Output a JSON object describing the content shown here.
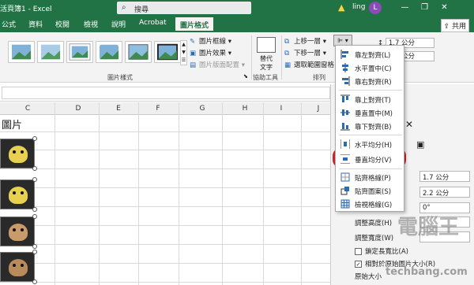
{
  "titlebar": {
    "title": "活頁簿1 - Excel",
    "search_placeholder": "搜尋",
    "user_name": "ling",
    "avatar_initial": "L",
    "minimize": "—",
    "restore": "❐",
    "close": "✕",
    "colors": {
      "accent": "#217346",
      "avatar": "#8b4bb9",
      "warning": "#ffd23a"
    }
  },
  "ribbon_tabs": [
    "公式",
    "資料",
    "校閱",
    "檢視",
    "說明",
    "Acrobat",
    "圖片格式"
  ],
  "active_tab": "圖片格式",
  "share_button": "共用",
  "ribbon": {
    "picture_border": "圖片框線",
    "picture_effects": "圖片效果",
    "picture_layout": "圖片版面配置",
    "picture_styles_group": "圖片樣式",
    "alt_text_line1": "替代",
    "alt_text_line2": "文字",
    "accessibility_group": "協助工具",
    "bring_forward": "上移一層",
    "send_backward": "下移一層",
    "selection_pane": "選取範圍窗格",
    "arrange_group": "排列",
    "height_value": "1.7 公分",
    "width_value": "2.2 公分"
  },
  "grid": {
    "columns": [
      "C",
      "D",
      "E",
      "F",
      "G",
      "H",
      "I",
      "J"
    ],
    "cell_heading": "圖片"
  },
  "align_menu": {
    "items": [
      {
        "label": "靠左對齊(L)",
        "icon": "align-left-icon"
      },
      {
        "label": "水平置中(C)",
        "icon": "align-center-icon"
      },
      {
        "label": "靠右對齊(R)",
        "icon": "align-right-icon"
      },
      {
        "label": "靠上對齊(T)",
        "icon": "align-top-icon"
      },
      {
        "label": "垂直置中(M)",
        "icon": "align-middle-icon"
      },
      {
        "label": "靠下對齊(B)",
        "icon": "align-bottom-icon"
      },
      {
        "label": "水平均分(H)",
        "icon": "distribute-horizontal-icon"
      },
      {
        "label": "垂直均分(V)",
        "icon": "distribute-vertical-icon"
      },
      {
        "label": "貼齊格線(P)",
        "icon": "snap-grid-icon"
      },
      {
        "label": "貼齊圖案(S)",
        "icon": "snap-shape-icon"
      },
      {
        "label": "檢視格線(G)",
        "icon": "view-gridlines-icon"
      }
    ],
    "highlighted": "垂直均分(V)",
    "highlight_color": "#c8262c"
  },
  "format_pane": {
    "height_value": "1.7 公分",
    "width_value": "2.2 公分",
    "rotation_value": "0°",
    "scale_height_label": "調整高度(H)",
    "scale_width_label": "調整寬度(W)",
    "lock_aspect": "鎖定長寬比(A)",
    "relative_original": "相對於原始圖片大小(R)",
    "original_size": "原始大小"
  },
  "watermark": {
    "line1": "電腦王",
    "line2": "techbang.com"
  }
}
